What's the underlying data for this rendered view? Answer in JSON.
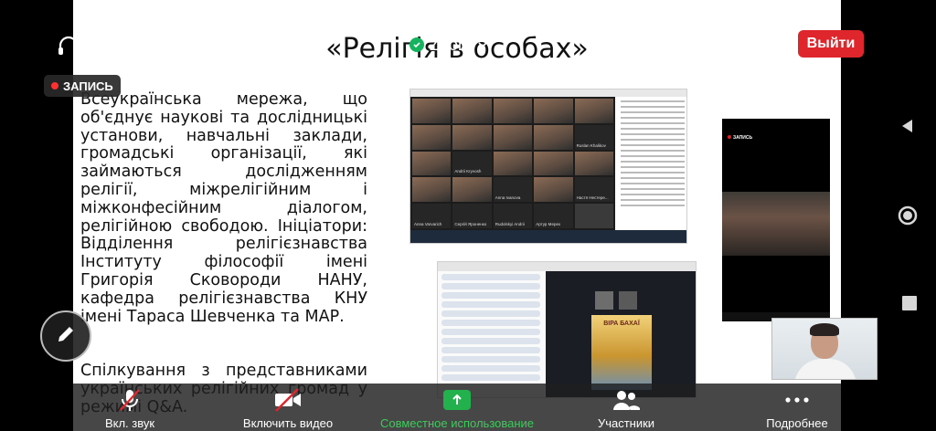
{
  "app": {
    "title": "Zoom",
    "leave_label": "Выйти",
    "recording_label": "ЗАПИСЬ"
  },
  "slide": {
    "title": "«Релігія в особах»",
    "paragraph1": "Всеукраїнська мережа, що об'єднує наукові та дослідницькі установи, навчальні заклади, громадські організації, які займаються дослідженням релігії, міжрелігійним і міжконфесійним діалогом, релігійною свободою. Ініціатори: Відділення релігієзнавства Інституту філософії імені Григорія Сковороди НАНУ, кафедра релігієзнавства КНУ імені Тараса Шевченка та МАР.",
    "paragraph2": "Спілкування з представниками українських релігійних громад у режимі Q&A."
  },
  "shot_participants": [
    "Andrii Kryvosh",
    "Ruslan Khalikov",
    "Andrii Kryvosh",
    "Anna Ivanova",
    "Настя Нестерe...",
    "Anna Varvarich",
    "Сергій Яроненко",
    "Rudolskyi Andrii",
    "Артур Мерех"
  ],
  "book_title": "ВІРА БАХАЇ",
  "phone": {
    "recording_label": "ЗАПИСЬ"
  },
  "toolbar": {
    "audio_label": "Вкл. звук",
    "video_label": "Включить видео",
    "share_label": "Совместное использование",
    "participants_label": "Участники",
    "more_label": "Подробнее"
  },
  "colors": {
    "leave": "#e0262d",
    "share": "#3ccc5a",
    "record_dot": "#ff3030",
    "toolbar": "#1e1e1e"
  },
  "icons": [
    "headphones-icon",
    "shield-check-icon",
    "chevron-down-icon",
    "pencil-icon",
    "mic-off-icon",
    "video-off-icon",
    "share-screen-icon",
    "participants-icon",
    "more-icon",
    "back-icon",
    "home-icon",
    "recent-apps-icon"
  ]
}
